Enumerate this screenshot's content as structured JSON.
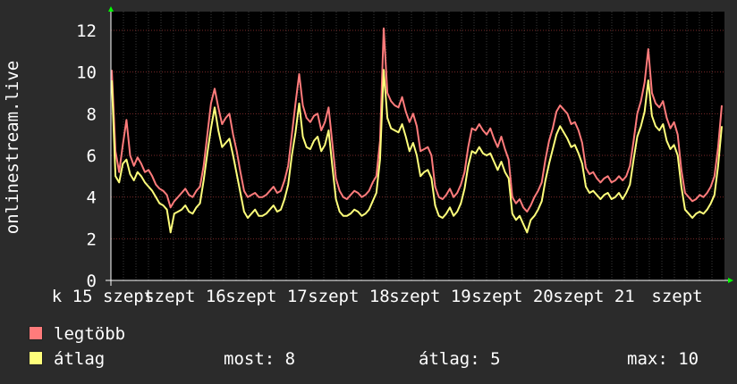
{
  "chart_data": {
    "type": "line",
    "ylabel": "onlinestream.live",
    "ylim": [
      0,
      13
    ],
    "yticks": [
      0,
      2,
      4,
      6,
      8,
      10,
      12
    ],
    "xticks": [
      "k 15 szept",
      "szept 16",
      "szept 17",
      "szept 18",
      "szept 19",
      "szept 20",
      "szept 21",
      "szept"
    ],
    "grid": true,
    "x_points_per_day": 24,
    "series": [
      {
        "name": "legtöbb",
        "color": "#ff7b7b",
        "values": [
          10.1,
          6.2,
          5.2,
          6.5,
          7.7,
          6.0,
          5.5,
          5.9,
          5.6,
          5.2,
          5.3,
          5.0,
          4.6,
          4.4,
          4.3,
          4.1,
          3.5,
          3.8,
          4.0,
          4.2,
          4.4,
          4.1,
          4.0,
          4.3,
          4.5,
          5.5,
          7.0,
          8.5,
          9.2,
          8.3,
          7.5,
          7.8,
          8.0,
          7.0,
          6.2,
          5.2,
          4.3,
          4.0,
          4.1,
          4.2,
          4.0,
          4.0,
          4.1,
          4.3,
          4.5,
          4.2,
          4.3,
          4.8,
          5.5,
          7.0,
          8.5,
          9.9,
          8.4,
          7.8,
          7.6,
          7.9,
          8.0,
          7.2,
          7.6,
          8.3,
          6.6,
          4.9,
          4.3,
          4.0,
          3.9,
          4.1,
          4.3,
          4.2,
          4.0,
          4.1,
          4.3,
          4.7,
          5.0,
          6.7,
          12.1,
          9.0,
          8.6,
          8.4,
          8.3,
          8.8,
          8.1,
          7.6,
          8.0,
          7.4,
          6.2,
          6.3,
          6.4,
          6.0,
          4.5,
          4.0,
          3.9,
          4.1,
          4.4,
          4.0,
          4.2,
          4.6,
          5.2,
          6.4,
          7.3,
          7.2,
          7.5,
          7.2,
          7.0,
          7.3,
          6.8,
          6.4,
          6.9,
          6.3,
          5.8,
          4.0,
          3.7,
          3.9,
          3.5,
          3.3,
          3.6,
          4.0,
          4.3,
          4.7,
          5.8,
          6.7,
          7.3,
          8.1,
          8.4,
          8.2,
          8.0,
          7.5,
          7.6,
          7.2,
          6.6,
          5.4,
          5.1,
          5.2,
          4.9,
          4.7,
          4.9,
          5.0,
          4.7,
          4.8,
          5.0,
          4.8,
          5.0,
          5.5,
          6.7,
          8.0,
          8.6,
          9.5,
          11.1,
          9.0,
          8.5,
          8.3,
          8.6,
          7.8,
          7.3,
          7.6,
          7.0,
          5.3,
          4.2,
          4.0,
          3.8,
          3.9,
          4.1,
          4.0,
          4.2,
          4.5,
          5.0,
          6.4,
          8.4
        ]
      },
      {
        "name": "átlag",
        "color": "#ffff7b",
        "values": [
          9.6,
          5.0,
          4.7,
          5.6,
          5.8,
          5.1,
          4.8,
          5.2,
          5.0,
          4.7,
          4.5,
          4.3,
          4.0,
          3.7,
          3.6,
          3.4,
          2.3,
          3.2,
          3.3,
          3.4,
          3.6,
          3.3,
          3.2,
          3.5,
          3.7,
          4.8,
          6.1,
          7.3,
          8.3,
          7.2,
          6.4,
          6.6,
          6.8,
          6.0,
          5.1,
          4.2,
          3.3,
          3.0,
          3.2,
          3.4,
          3.1,
          3.1,
          3.2,
          3.4,
          3.6,
          3.3,
          3.4,
          3.9,
          4.6,
          6.0,
          7.1,
          8.5,
          6.9,
          6.4,
          6.3,
          6.7,
          6.9,
          6.2,
          6.5,
          7.2,
          5.5,
          3.9,
          3.3,
          3.1,
          3.1,
          3.2,
          3.4,
          3.3,
          3.1,
          3.2,
          3.4,
          3.8,
          4.2,
          5.8,
          10.1,
          7.8,
          7.3,
          7.2,
          7.1,
          7.5,
          6.9,
          6.2,
          6.6,
          6.0,
          5.0,
          5.2,
          5.3,
          4.9,
          3.6,
          3.1,
          3.0,
          3.2,
          3.5,
          3.1,
          3.3,
          3.7,
          4.4,
          5.5,
          6.2,
          6.1,
          6.4,
          6.1,
          6.0,
          6.1,
          5.7,
          5.3,
          5.7,
          5.2,
          4.9,
          3.2,
          2.9,
          3.1,
          2.7,
          2.3,
          2.9,
          3.1,
          3.4,
          3.8,
          4.8,
          5.6,
          6.3,
          7.0,
          7.4,
          7.1,
          6.8,
          6.4,
          6.5,
          6.1,
          5.6,
          4.5,
          4.2,
          4.3,
          4.1,
          3.9,
          4.1,
          4.2,
          3.9,
          4.0,
          4.2,
          3.9,
          4.2,
          4.6,
          5.8,
          6.9,
          7.4,
          8.1,
          9.6,
          7.9,
          7.4,
          7.2,
          7.5,
          6.7,
          6.3,
          6.5,
          6.0,
          4.5,
          3.4,
          3.2,
          3.0,
          3.2,
          3.3,
          3.2,
          3.4,
          3.7,
          4.1,
          5.5,
          7.4
        ]
      }
    ]
  },
  "legend": [
    {
      "label": "legtöbb",
      "color": "#ff7b7b"
    },
    {
      "label": "átlag",
      "color": "#ffff7b"
    }
  ],
  "stats": {
    "most": "most: 8",
    "atlag": "átlag: 5",
    "max": "max: 10"
  }
}
